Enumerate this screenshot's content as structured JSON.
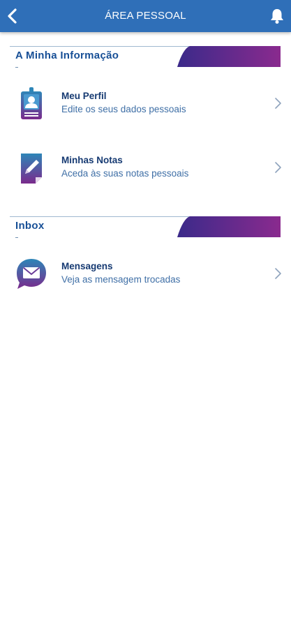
{
  "header": {
    "title": "ÁREA PESSOAL",
    "back_icon": "chevron-left-icon",
    "bell_icon": "bell-icon"
  },
  "colors": {
    "header": "#2f6fb8",
    "section_title": "#174f96",
    "item_title": "#163a72",
    "item_desc": "#3f6fa6",
    "accent_start": "#3b2a8a",
    "accent_end": "#8a2a8e"
  },
  "sections": [
    {
      "title": "A Minha Informação",
      "items": [
        {
          "title": "Meu Perfil",
          "subtitle": "Edite os seus dados pessoais",
          "icon": "id-badge-icon"
        },
        {
          "title": "Minhas Notas",
          "subtitle": "Aceda às suas notas pessoais",
          "icon": "note-edit-icon"
        }
      ]
    },
    {
      "title": "Inbox",
      "items": [
        {
          "title": "Mensagens",
          "subtitle": "Veja as mensagem trocadas",
          "icon": "message-envelope-icon"
        }
      ]
    }
  ]
}
